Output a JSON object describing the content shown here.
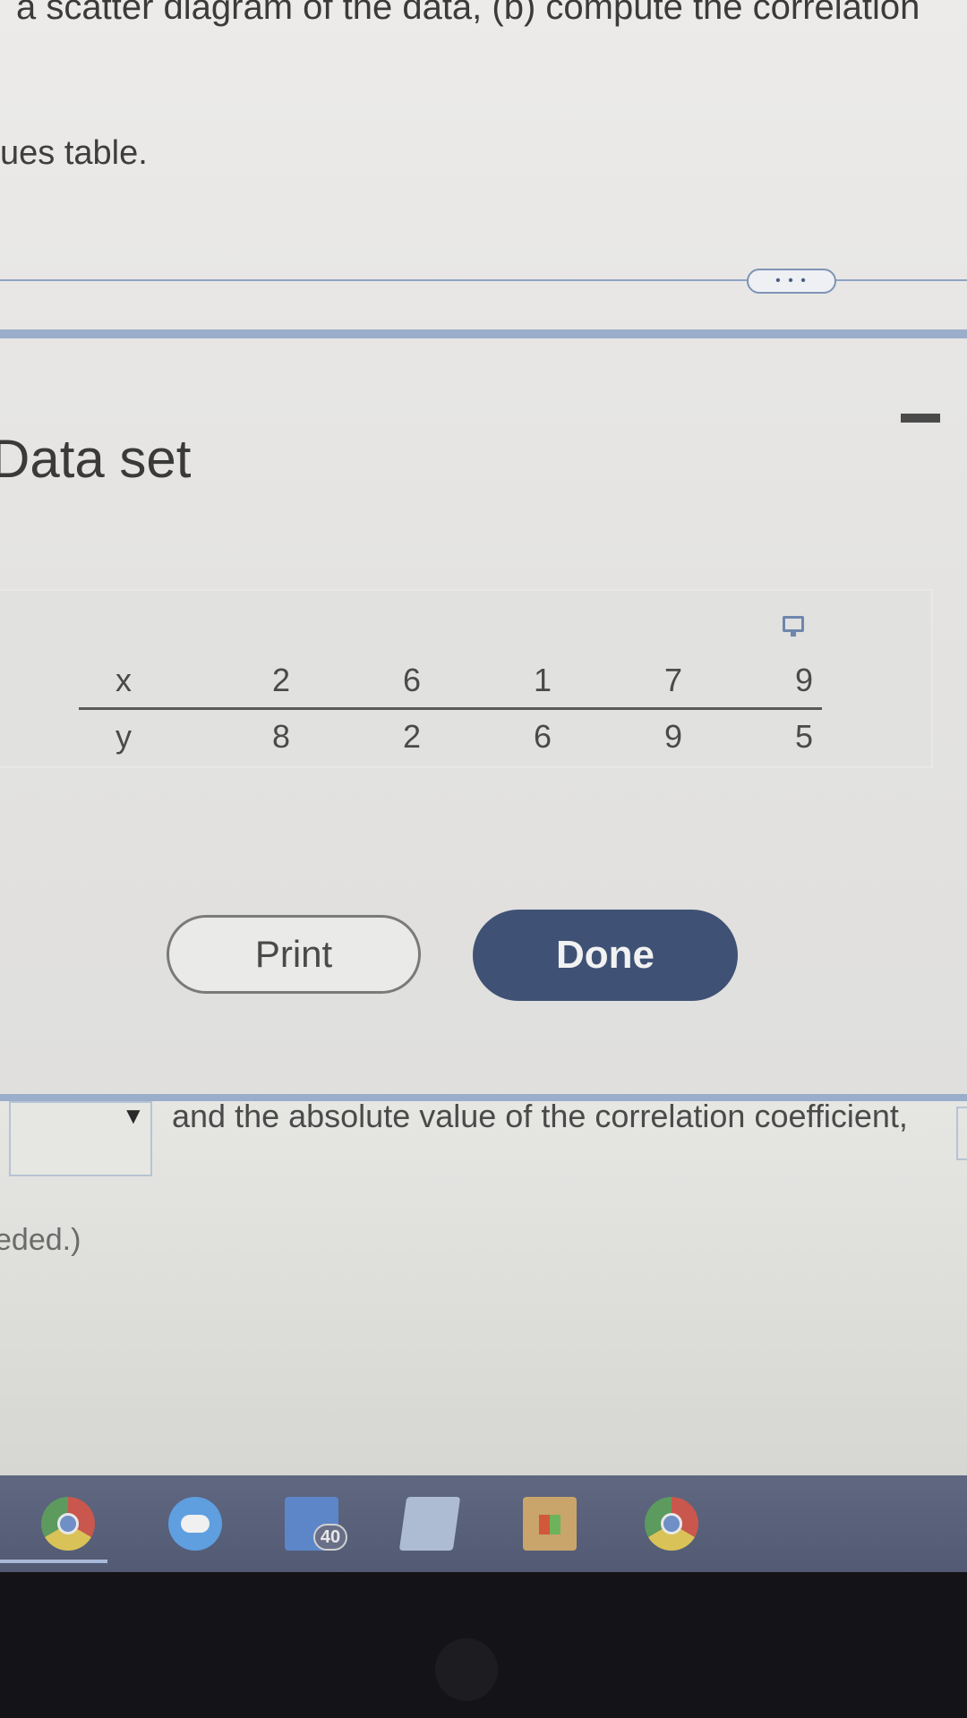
{
  "question": {
    "line1": "a scatter diagram of the data, (b) compute the correlation",
    "line2": "ues table."
  },
  "more_button_label": "• • •",
  "dialog": {
    "title": "Data set",
    "table": {
      "row_labels": [
        "x",
        "y"
      ],
      "x_values": [
        "2",
        "6",
        "1",
        "7",
        "9"
      ],
      "y_values": [
        "8",
        "2",
        "6",
        "9",
        "5"
      ]
    },
    "print_label": "Print",
    "done_label": "Done"
  },
  "answer_area": {
    "dropdown_arrow": "▼",
    "sentence": "and the absolute value of the correlation coefficient,",
    "hint": "eded.)"
  },
  "taskbar": {
    "badge_count": "40"
  },
  "colors": {
    "accent_dark": "#3f5275",
    "rule_blue": "#9aaecb",
    "taskbar": "#5a627c"
  },
  "icons": [
    "minimize-icon",
    "copy-icon",
    "chrome-icon",
    "chat-icon",
    "folder-icon",
    "store-icon"
  ]
}
